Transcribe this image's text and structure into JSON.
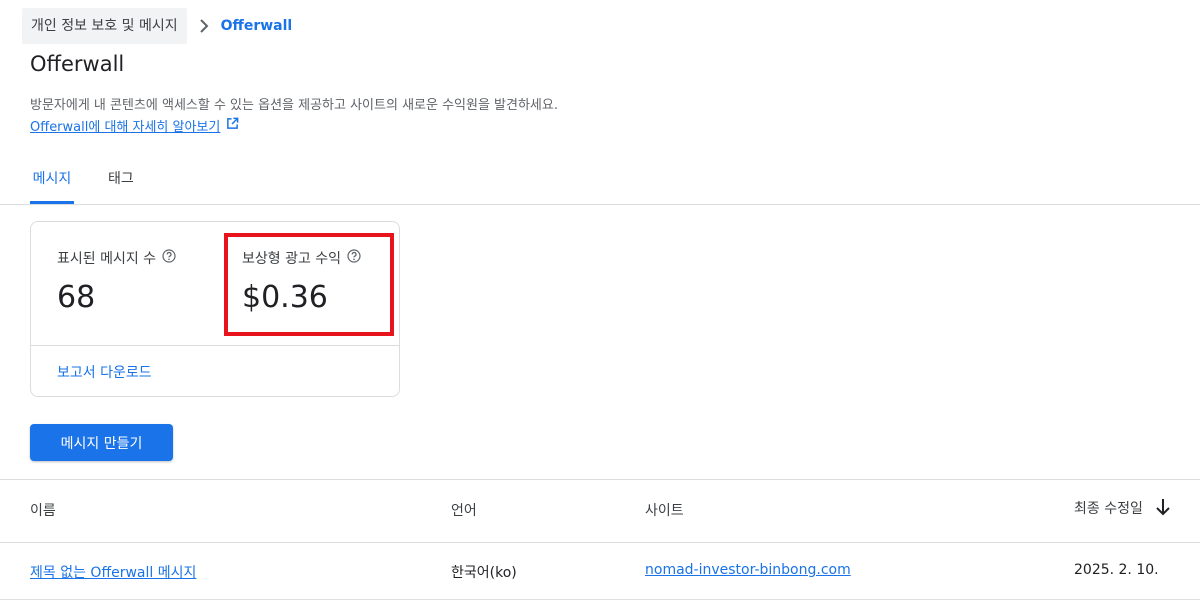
{
  "breadcrumb": {
    "parent": "개인 정보 보호 및 메시지",
    "current": "Offerwall"
  },
  "header": {
    "title": "Offerwall",
    "description": "방문자에게 내 콘텐츠에 액세스할 수 있는 옵션을 제공하고 사이트의 새로운 수익원을 발견하세요.",
    "learn_more": "Offerwall에 대해 자세히 알아보기"
  },
  "tabs": [
    {
      "label": "메시지",
      "active": true
    },
    {
      "label": "태그",
      "active": false
    }
  ],
  "stats": {
    "messages_shown": {
      "label": "표시된 메시지 수",
      "value": "68"
    },
    "rewarded_revenue": {
      "label": "보상형 광고 수익",
      "value": "$0.36"
    },
    "download_report": "보고서 다운로드"
  },
  "actions": {
    "create_message": "메시지 만들기"
  },
  "table": {
    "headers": {
      "name": "이름",
      "language": "언어",
      "site": "사이트",
      "modified": "최종 수정일"
    },
    "rows": [
      {
        "name": "제목 없는 Offerwall 메시지",
        "language": "한국어(ko)",
        "site": "nomad-investor-binbong.com",
        "modified": "2025. 2. 10."
      }
    ]
  },
  "colors": {
    "accent": "#1a73e8",
    "highlight": "#e8141d"
  }
}
